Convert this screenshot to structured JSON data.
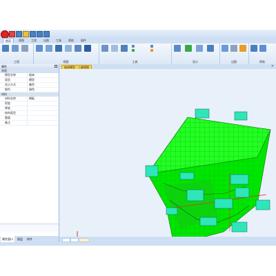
{
  "app": {
    "title": ""
  },
  "ribbon": {
    "tabs": [
      "首页",
      "视图",
      "工程",
      "出图",
      "工具",
      "帮助",
      "插件"
    ],
    "groups": [
      {
        "id": "g1",
        "label": "工程"
      },
      {
        "id": "g2",
        "label": "视图"
      },
      {
        "id": "g3",
        "label": "工具"
      },
      {
        "id": "g4",
        "label": "显示"
      },
      {
        "id": "g5",
        "label": "出图"
      },
      {
        "id": "g6",
        "label": "帮助"
      }
    ]
  },
  "panel": {
    "title": "属性",
    "category1": "常规",
    "rows1": [
      {
        "k": "模型名称",
        "v": "船体"
      },
      {
        "k": "类型",
        "v": "模型"
      },
      {
        "k": "显示方式",
        "v": "着色"
      },
      {
        "k": "颜色",
        "v": "绿色"
      }
    ],
    "category2": "材料",
    "rows2": [
      {
        "k": "材料名称",
        "v": "钢板"
      },
      {
        "k": "密度",
        "v": ""
      },
      {
        "k": "厚度",
        "v": ""
      },
      {
        "k": "结构类型",
        "v": ""
      },
      {
        "k": "重量",
        "v": ""
      },
      {
        "k": "备注",
        "v": ""
      }
    ],
    "bottom_tabs": [
      "属性窗口",
      "图层",
      "构件"
    ]
  },
  "document": {
    "tab_label": "船体模型 - 三维视图"
  },
  "viewport": {
    "hull_color": "#00ff00",
    "label_color": "#2ee6b8"
  }
}
